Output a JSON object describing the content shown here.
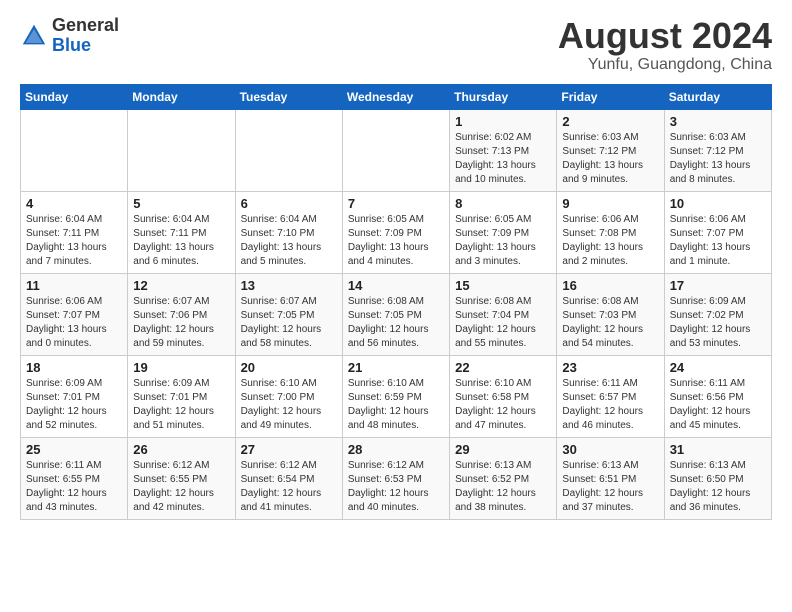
{
  "header": {
    "logo_general": "General",
    "logo_blue": "Blue",
    "month_title": "August 2024",
    "location": "Yunfu, Guangdong, China"
  },
  "weekdays": [
    "Sunday",
    "Monday",
    "Tuesday",
    "Wednesday",
    "Thursday",
    "Friday",
    "Saturday"
  ],
  "weeks": [
    [
      {
        "day": "",
        "info": ""
      },
      {
        "day": "",
        "info": ""
      },
      {
        "day": "",
        "info": ""
      },
      {
        "day": "",
        "info": ""
      },
      {
        "day": "1",
        "info": "Sunrise: 6:02 AM\nSunset: 7:13 PM\nDaylight: 13 hours and 10 minutes."
      },
      {
        "day": "2",
        "info": "Sunrise: 6:03 AM\nSunset: 7:12 PM\nDaylight: 13 hours and 9 minutes."
      },
      {
        "day": "3",
        "info": "Sunrise: 6:03 AM\nSunset: 7:12 PM\nDaylight: 13 hours and 8 minutes."
      }
    ],
    [
      {
        "day": "4",
        "info": "Sunrise: 6:04 AM\nSunset: 7:11 PM\nDaylight: 13 hours and 7 minutes."
      },
      {
        "day": "5",
        "info": "Sunrise: 6:04 AM\nSunset: 7:11 PM\nDaylight: 13 hours and 6 minutes."
      },
      {
        "day": "6",
        "info": "Sunrise: 6:04 AM\nSunset: 7:10 PM\nDaylight: 13 hours and 5 minutes."
      },
      {
        "day": "7",
        "info": "Sunrise: 6:05 AM\nSunset: 7:09 PM\nDaylight: 13 hours and 4 minutes."
      },
      {
        "day": "8",
        "info": "Sunrise: 6:05 AM\nSunset: 7:09 PM\nDaylight: 13 hours and 3 minutes."
      },
      {
        "day": "9",
        "info": "Sunrise: 6:06 AM\nSunset: 7:08 PM\nDaylight: 13 hours and 2 minutes."
      },
      {
        "day": "10",
        "info": "Sunrise: 6:06 AM\nSunset: 7:07 PM\nDaylight: 13 hours and 1 minute."
      }
    ],
    [
      {
        "day": "11",
        "info": "Sunrise: 6:06 AM\nSunset: 7:07 PM\nDaylight: 13 hours and 0 minutes."
      },
      {
        "day": "12",
        "info": "Sunrise: 6:07 AM\nSunset: 7:06 PM\nDaylight: 12 hours and 59 minutes."
      },
      {
        "day": "13",
        "info": "Sunrise: 6:07 AM\nSunset: 7:05 PM\nDaylight: 12 hours and 58 minutes."
      },
      {
        "day": "14",
        "info": "Sunrise: 6:08 AM\nSunset: 7:05 PM\nDaylight: 12 hours and 56 minutes."
      },
      {
        "day": "15",
        "info": "Sunrise: 6:08 AM\nSunset: 7:04 PM\nDaylight: 12 hours and 55 minutes."
      },
      {
        "day": "16",
        "info": "Sunrise: 6:08 AM\nSunset: 7:03 PM\nDaylight: 12 hours and 54 minutes."
      },
      {
        "day": "17",
        "info": "Sunrise: 6:09 AM\nSunset: 7:02 PM\nDaylight: 12 hours and 53 minutes."
      }
    ],
    [
      {
        "day": "18",
        "info": "Sunrise: 6:09 AM\nSunset: 7:01 PM\nDaylight: 12 hours and 52 minutes."
      },
      {
        "day": "19",
        "info": "Sunrise: 6:09 AM\nSunset: 7:01 PM\nDaylight: 12 hours and 51 minutes."
      },
      {
        "day": "20",
        "info": "Sunrise: 6:10 AM\nSunset: 7:00 PM\nDaylight: 12 hours and 49 minutes."
      },
      {
        "day": "21",
        "info": "Sunrise: 6:10 AM\nSunset: 6:59 PM\nDaylight: 12 hours and 48 minutes."
      },
      {
        "day": "22",
        "info": "Sunrise: 6:10 AM\nSunset: 6:58 PM\nDaylight: 12 hours and 47 minutes."
      },
      {
        "day": "23",
        "info": "Sunrise: 6:11 AM\nSunset: 6:57 PM\nDaylight: 12 hours and 46 minutes."
      },
      {
        "day": "24",
        "info": "Sunrise: 6:11 AM\nSunset: 6:56 PM\nDaylight: 12 hours and 45 minutes."
      }
    ],
    [
      {
        "day": "25",
        "info": "Sunrise: 6:11 AM\nSunset: 6:55 PM\nDaylight: 12 hours and 43 minutes."
      },
      {
        "day": "26",
        "info": "Sunrise: 6:12 AM\nSunset: 6:55 PM\nDaylight: 12 hours and 42 minutes."
      },
      {
        "day": "27",
        "info": "Sunrise: 6:12 AM\nSunset: 6:54 PM\nDaylight: 12 hours and 41 minutes."
      },
      {
        "day": "28",
        "info": "Sunrise: 6:12 AM\nSunset: 6:53 PM\nDaylight: 12 hours and 40 minutes."
      },
      {
        "day": "29",
        "info": "Sunrise: 6:13 AM\nSunset: 6:52 PM\nDaylight: 12 hours and 38 minutes."
      },
      {
        "day": "30",
        "info": "Sunrise: 6:13 AM\nSunset: 6:51 PM\nDaylight: 12 hours and 37 minutes."
      },
      {
        "day": "31",
        "info": "Sunrise: 6:13 AM\nSunset: 6:50 PM\nDaylight: 12 hours and 36 minutes."
      }
    ]
  ]
}
